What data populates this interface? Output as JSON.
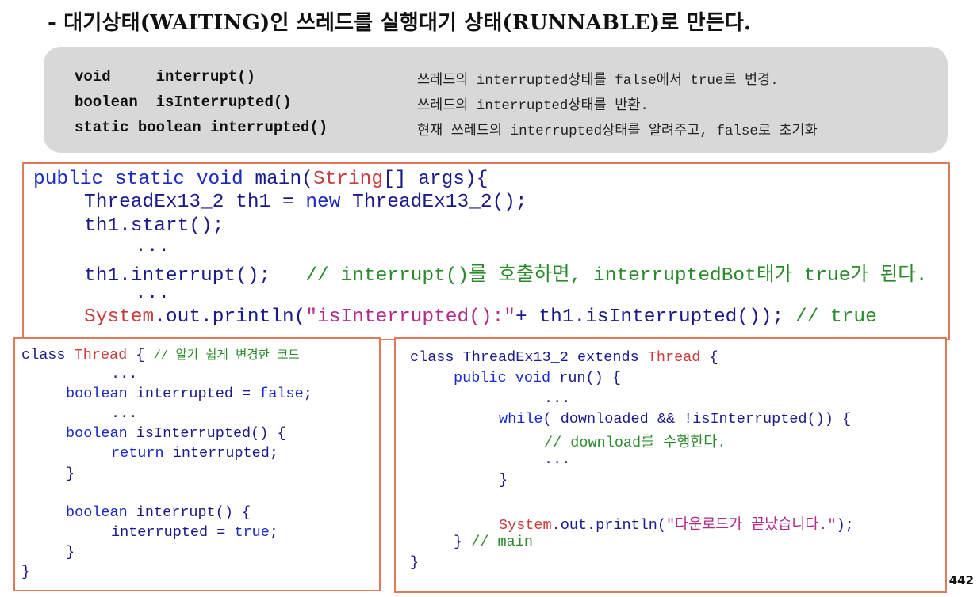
{
  "title": "- 대기상태(WAITING)인 쓰레드를 실행대기 상태(RUNNABLE)로 만든다.",
  "methods": [
    {
      "signature": "void     interrupt()",
      "description": "쓰레드의 interrupted상태를 false에서 true로 변경."
    },
    {
      "signature": "boolean  isInterrupted()",
      "description": "쓰레드의 interrupted상태를 반환."
    },
    {
      "signature": "static boolean interrupted()",
      "description": "현재 쓰레드의 interrupted상태를 알려주고, false로 초기화"
    }
  ],
  "main_code": {
    "l1a": "public static void",
    "l1b": " main(",
    "l1c": "String",
    "l1d": "[] args){",
    "l2a": "ThreadEx13_2 th1 = ",
    "l2b": "new",
    "l2c": " ThreadEx13_2();",
    "l3": "th1.start();",
    "l4": "...",
    "l5a": "th1.interrupt();   ",
    "l5b": "// interrupt()를 호출하면, interruptedBot태가 true가 된다.",
    "l6": "...",
    "l7a": "System",
    "l7b": ".out.println(",
    "l7c": "\"isInterrupted():\"",
    "l7d": "+ th1.isInterrupted()); ",
    "l7e": "// true"
  },
  "thread_class": {
    "l1a": "class ",
    "l1b": "Thread",
    "l1c": " { ",
    "l1d": "// 알기 쉽게 변경한 코드",
    "l2": "...",
    "l3a": "boolean",
    "l3b": " interrupted = ",
    "l3c": "false",
    "l3d": ";",
    "l4": "...",
    "l5a": "boolean",
    "l5b": " isInterrupted() {",
    "l6a": "return",
    "l6b": " interrupted;",
    "l7": "}",
    "l8a": "boolean",
    "l8b": " interrupt() {",
    "l9a": "interrupted = ",
    "l9b": "true",
    "l9c": ";",
    "l10": "}",
    "l11": "}"
  },
  "threadex_class": {
    "l1a": "class",
    "l1b": " ThreadEx13_2 ",
    "l1c": "extends",
    "l1d": " ",
    "l1e": "Thread",
    "l1f": " {",
    "l2a": "public void",
    "l2b": " run() {",
    "l3": "...",
    "l4a": "while",
    "l4b": "( downloaded && !isInterrupted()) {",
    "l5": "// download를 수행한다.",
    "l6": "...",
    "l7": "}",
    "l8a": "System",
    "l8b": ".out.println(",
    "l8c": "\"다운로드가 끝났습니다.\"",
    "l8d": ");",
    "l9a": "} ",
    "l9b": "// main",
    "l10": "}"
  },
  "page_number": "442"
}
